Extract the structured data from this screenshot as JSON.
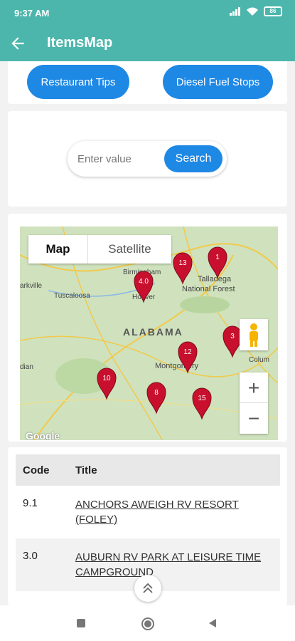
{
  "status": {
    "time": "9:37 AM",
    "battery": "86"
  },
  "header": {
    "title": "ItemsMap"
  },
  "filters": {
    "restaurant_tips": "Restaurant Tips",
    "diesel_fuel_stops": "Diesel Fuel Stops"
  },
  "search": {
    "placeholder": "Enter value",
    "button": "Search"
  },
  "map": {
    "type_map": "Map",
    "type_satellite": "Satellite",
    "zoom_in": "+",
    "zoom_out": "−",
    "state_label": "ALABAMA",
    "place_labels": [
      "Birmingham",
      "Talladega",
      "National Forest",
      "Tuscaloosa",
      "Hoover",
      "Montgomery",
      "Colum",
      "arkville",
      "dian",
      "Google"
    ],
    "markers": [
      "13",
      "1",
      "4.0",
      "12",
      "3",
      "10",
      "8",
      "15"
    ],
    "marker_color": "#c8102e"
  },
  "table": {
    "headers": [
      "Code",
      "Title"
    ],
    "rows": [
      {
        "code": "9.1",
        "title": "ANCHORS AWEIGH RV RESORT (FOLEY)"
      },
      {
        "code": "3.0",
        "title": "AUBURN RV PARK AT LEISURE TIME CAMPGROUND"
      }
    ]
  },
  "colors": {
    "accent": "#4db6ac",
    "button": "#1e88e5"
  }
}
